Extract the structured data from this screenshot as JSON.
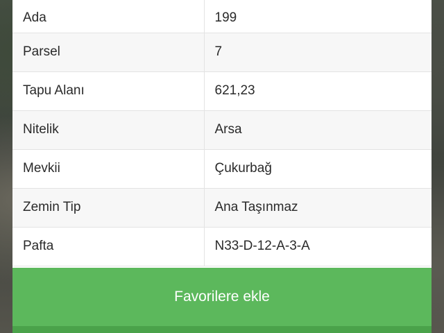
{
  "parcel_info": {
    "rows": [
      {
        "label": "Ada",
        "value": "199"
      },
      {
        "label": "Parsel",
        "value": "7"
      },
      {
        "label": "Tapu Alanı",
        "value": "621,23"
      },
      {
        "label": "Nitelik",
        "value": "Arsa"
      },
      {
        "label": "Mevkii",
        "value": "Çukurbağ"
      },
      {
        "label": "Zemin Tip",
        "value": "Ana Taşınmaz"
      },
      {
        "label": "Pafta",
        "value": "N33-D-12-A-3-A"
      }
    ]
  },
  "actions": {
    "favorite_label": "Favorilere ekle"
  },
  "colors": {
    "button_green": "#5cb85c",
    "panel_background": "#ffffff",
    "stripe_row": "#f7f7f7"
  }
}
